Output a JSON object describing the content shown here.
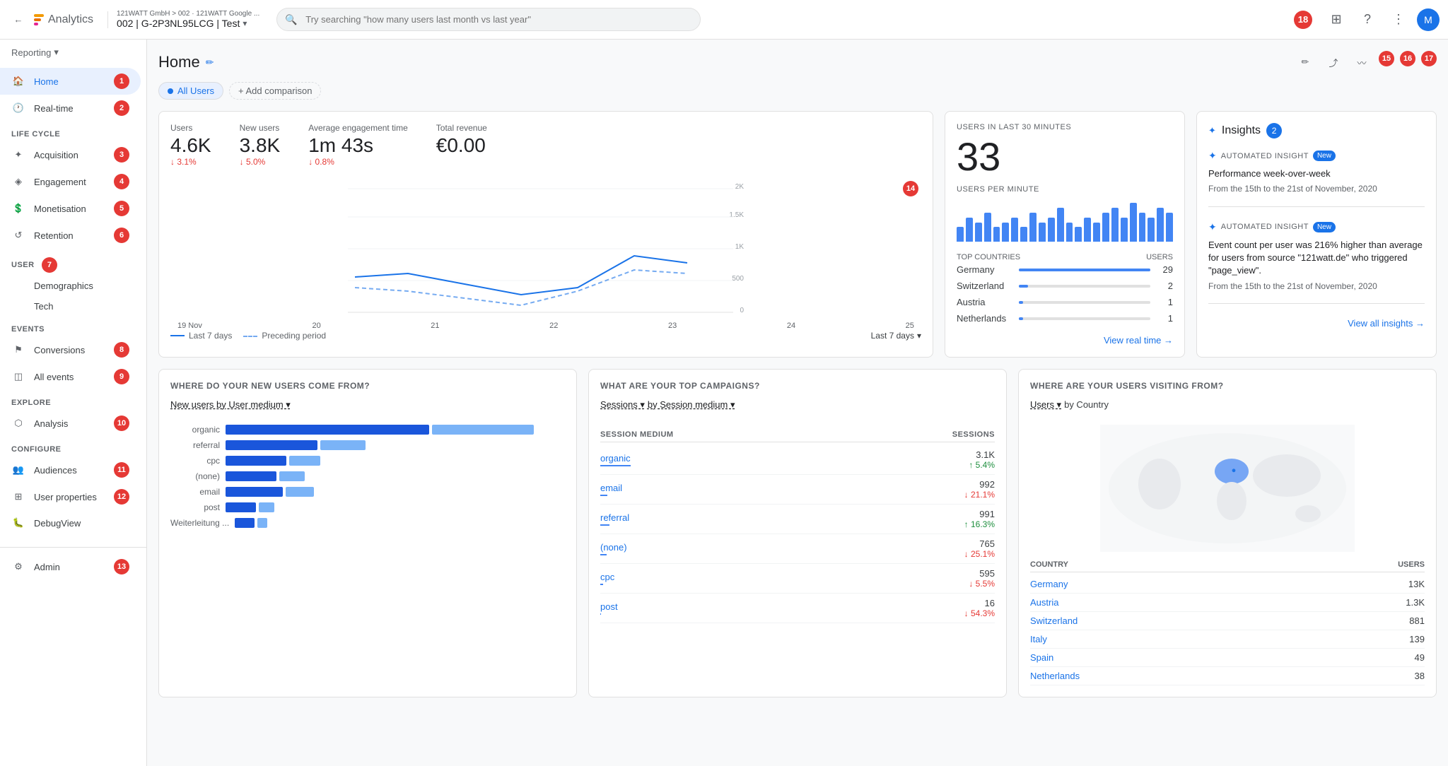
{
  "topbar": {
    "back_label": "←",
    "app_name": "Analytics",
    "account_path": "121WATT GmbH > 002 · 121WATT Google ...",
    "account_id": "002 | G-2P3NL95LCG | Test",
    "account_chevron": "▾",
    "search_placeholder": "Try searching \"how many users last month vs last year\"",
    "notif_count": "18",
    "grid_icon": "⊞",
    "help_icon": "?",
    "more_icon": "⋮",
    "avatar_initials": "M"
  },
  "sidebar": {
    "reporting_label": "Reporting",
    "reporting_chevron": "▾",
    "home_label": "Home",
    "home_badge": "1",
    "realtime_label": "Real-time",
    "realtime_badge": "2",
    "lifecycle_label": "LIFE CYCLE",
    "acquisition_label": "Acquisition",
    "acquisition_badge": "3",
    "engagement_label": "Engagement",
    "engagement_badge": "4",
    "monetisation_label": "Monetisation",
    "monetisation_badge": "5",
    "retention_label": "Retention",
    "retention_badge": "6",
    "user_label": "USER",
    "user_badge": "7",
    "demographics_label": "Demographics",
    "tech_label": "Tech",
    "events_label": "EVENTS",
    "conversions_label": "Conversions",
    "conversions_badge": "8",
    "allevents_label": "All events",
    "allevents_badge": "9",
    "explore_label": "EXPLORE",
    "analysis_label": "Analysis",
    "analysis_badge": "10",
    "configure_label": "CONFIGURE",
    "audiences_label": "Audiences",
    "audiences_badge": "11",
    "userprops_label": "User properties",
    "userprops_badge": "12",
    "debugview_label": "DebugView",
    "admin_label": "Admin",
    "admin_badge": "13"
  },
  "page": {
    "title": "Home",
    "filter_label": "All Users",
    "add_comparison": "+ Add comparison"
  },
  "metrics": {
    "users_label": "Users",
    "users_value": "4.6K",
    "users_change": "↓ 3.1%",
    "users_change_dir": "down",
    "newusers_label": "New users",
    "newusers_value": "3.8K",
    "newusers_change": "↓ 5.0%",
    "newusers_change_dir": "down",
    "engagement_label": "Average engagement time",
    "engagement_value": "1m 43s",
    "engagement_change": "↓ 0.8%",
    "engagement_change_dir": "down",
    "revenue_label": "Total revenue",
    "revenue_value": "€0.00",
    "badge_14": "14"
  },
  "chart": {
    "x_labels": [
      "19 Nov",
      "20",
      "21",
      "22",
      "23",
      "24",
      "25"
    ],
    "y_labels": [
      "2K",
      "1.5K",
      "1K",
      "500",
      "0"
    ],
    "legend_solid": "Last 7 days",
    "legend_dashed": "Preceding period",
    "period_label": "Last 7 days",
    "period_chevron": "▾"
  },
  "realtime": {
    "section_label": "USERS IN LAST 30 MINUTES",
    "value": "33",
    "sublabel": "USERS PER MINUTE",
    "countries_header": "TOP COUNTRIES",
    "users_col": "USERS",
    "countries": [
      {
        "name": "Germany",
        "count": "29",
        "pct": 100
      },
      {
        "name": "Switzerland",
        "count": "2",
        "pct": 7
      },
      {
        "name": "Austria",
        "count": "1",
        "pct": 3
      },
      {
        "name": "Netherlands",
        "count": "1",
        "pct": 3
      }
    ],
    "view_link": "View real time →",
    "rt_bars": [
      3,
      5,
      4,
      6,
      3,
      4,
      5,
      3,
      6,
      4,
      5,
      7,
      4,
      3,
      5,
      4,
      6,
      7,
      5,
      8,
      6,
      5,
      7,
      6
    ]
  },
  "insights": {
    "title": "Insights",
    "count": "2",
    "item1_tag": "AUTOMATED INSIGHT",
    "item1_new": "New",
    "item1_title": "Performance week-over-week",
    "item1_sub": "From the 15th to the 21st of November, 2020",
    "item2_tag": "AUTOMATED INSIGHT",
    "item2_new": "New",
    "item2_title": "Event count per user was 216% higher than average for users from source \"121watt.de\" who triggered \"page_view\".",
    "item2_sub": "From the 15th to the 21st of November, 2020",
    "view_link": "View all insights →"
  },
  "newusers": {
    "section_title": "WHERE DO YOUR NEW USERS COME FROM?",
    "selector": "New users by User medium ▾",
    "labels": [
      "organic",
      "referral",
      "cpc",
      "(none)",
      "email",
      "post",
      "Weiterleitung ..."
    ],
    "values": [
      100,
      45,
      30,
      25,
      28,
      15,
      10
    ]
  },
  "campaigns": {
    "section_title": "WHAT ARE YOUR TOP CAMPAIGNS?",
    "selector_left": "Sessions ▾",
    "selector_right": "by Session medium ▾",
    "col1": "SESSION MEDIUM",
    "col2": "SESSIONS",
    "rows": [
      {
        "name": "organic",
        "value": "3.1K",
        "change": "↑ 5.4%",
        "dir": "up",
        "bar_pct": 100
      },
      {
        "name": "email",
        "value": "992",
        "change": "↓ 21.1%",
        "dir": "down",
        "bar_pct": 32
      },
      {
        "name": "referral",
        "value": "991",
        "change": "↑ 16.3%",
        "dir": "up",
        "bar_pct": 32
      },
      {
        "name": "(none)",
        "value": "765",
        "change": "↓ 25.1%",
        "dir": "down",
        "bar_pct": 25
      },
      {
        "name": "cpc",
        "value": "595",
        "change": "↓ 5.5%",
        "dir": "down",
        "bar_pct": 19
      },
      {
        "name": "post",
        "value": "16",
        "change": "↓ 54.3%",
        "dir": "down",
        "bar_pct": 1
      }
    ]
  },
  "geo": {
    "section_title": "WHERE ARE YOUR USERS VISITING FROM?",
    "selector_left": "Users ▾",
    "selector_right": "by Country",
    "col1": "COUNTRY",
    "col2": "USERS",
    "countries": [
      {
        "name": "Germany",
        "value": "13K"
      },
      {
        "name": "Austria",
        "value": "1.3K"
      },
      {
        "name": "Switzerland",
        "value": "881"
      },
      {
        "name": "Italy",
        "value": "139"
      },
      {
        "name": "Spain",
        "value": "49"
      },
      {
        "name": "Netherlands",
        "value": "38"
      }
    ]
  }
}
